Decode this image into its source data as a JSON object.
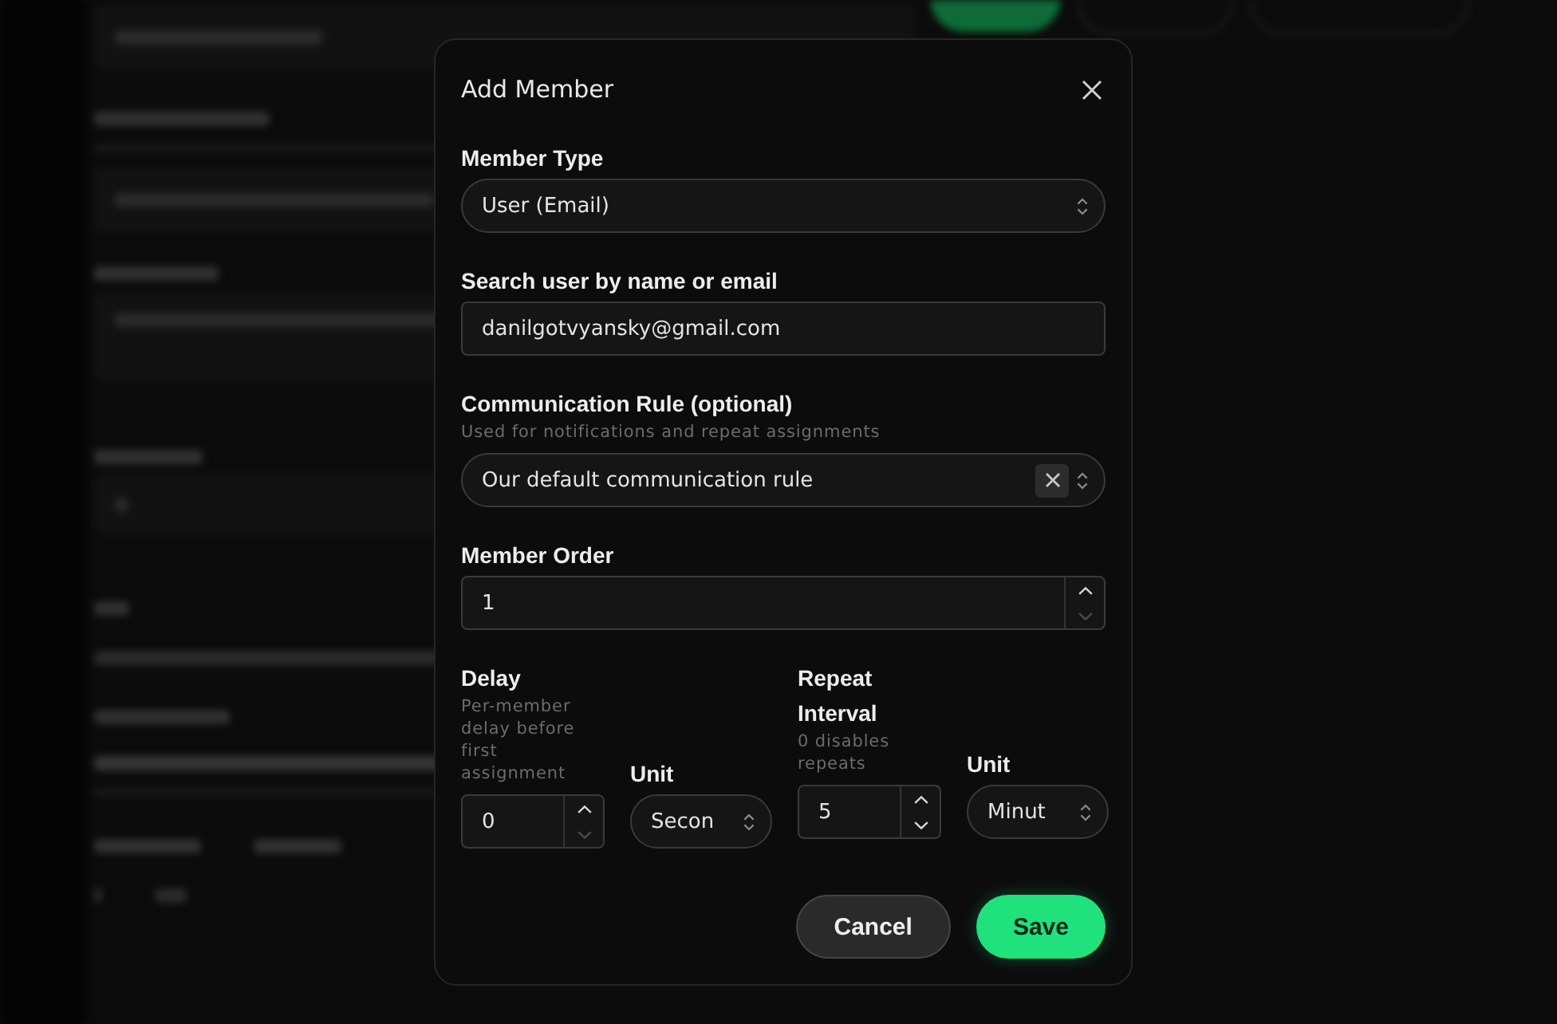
{
  "dialog": {
    "title": "Add Member"
  },
  "fields": [
    {
      "kind": "select",
      "label": "Member Type",
      "value": "User (Email)"
    },
    {
      "kind": "text",
      "label": "Search user by name or email",
      "value": "danilgotvyansky@gmail.com"
    },
    {
      "kind": "select",
      "label": "Communication Rule (optional)",
      "help": "Used for notifications and repeat assignments",
      "value": "Our default communication rule",
      "clearable": true
    },
    {
      "kind": "number",
      "label": "Member Order",
      "value": "1",
      "decrement_disabled": true
    }
  ],
  "timing": [
    {
      "amount": {
        "kind": "number",
        "label": "Delay",
        "help": "Per-member delay before first assignment",
        "value": "0",
        "decrement_disabled": true
      },
      "unit": {
        "kind": "select",
        "label": "Unit",
        "value": "Secon"
      }
    },
    {
      "amount": {
        "kind": "number",
        "label": "Repeat Interval",
        "help": "0 disables repeats",
        "value": "5",
        "decrement_disabled": false
      },
      "unit": {
        "kind": "select",
        "label": "Unit",
        "value": "Minut"
      }
    }
  ],
  "buttons": [
    {
      "kind": "secondary",
      "label": "Cancel"
    },
    {
      "kind": "primary",
      "label": "Save"
    }
  ]
}
